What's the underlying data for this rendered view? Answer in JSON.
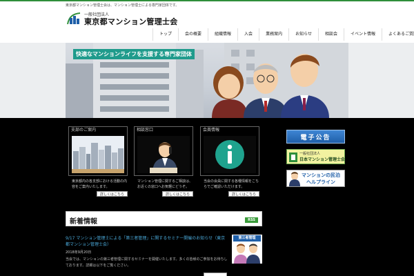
{
  "header": {
    "tagline": "東京都マンション管理士会は、マンション管理士による専門家団体です。",
    "logo_sub": "一般社団法人",
    "logo_main": "東京都マンション管理士会"
  },
  "nav": {
    "items": [
      "トップ",
      "会の概要",
      "組織情報",
      "入会",
      "業務案内",
      "お知らせ",
      "相談会",
      "イベント情報",
      "よくあるご質問"
    ]
  },
  "hero": {
    "banner": "快適なマンションライフを支援する専門家団体"
  },
  "features": [
    {
      "title": "支部のご案内",
      "text": "東京都内の各支部における活動の内容をご案内いたします。",
      "more": "詳しくはこちら"
    },
    {
      "title": "相談窓口",
      "text": "マンション管理に関するご相談は、お近くの窓口へお気軽にどうぞ。",
      "more": "詳しくはこちら"
    },
    {
      "title": "会員情報",
      "text": "当会の会員に関する各種情報をこちらでご確認いただけます。",
      "more": "詳しくはこちら"
    }
  ],
  "sidebar": {
    "public_notice": "電子公告",
    "nikkanren_sub": "一般社団法人",
    "nikkanren_main": "日本マンション管理士会連合会",
    "helpline_line1": "マンションの民泊",
    "helpline_line2": "ヘルプライン"
  },
  "news": {
    "title": "新着情報",
    "rss": "RSS",
    "item_link": "9/17 マンション管理士による「第三者管理」に関するセミナー開催のお知らせ（東京都マンション管理士会）",
    "item_date": "2018年9月20日",
    "item_body": "当会では、マンションの第三者管理に関するセミナーを開催いたします。多くの皆様のご参加をお待ちしております。詳細は以下をご覧ください。",
    "thumb_label": "第三者管理"
  },
  "colors": {
    "brand_green": "#2f8f3a",
    "banner_teal": "#1f9b8c",
    "link_blue": "#4aa8d8",
    "sidebar_blue": "#1f5fa8"
  }
}
